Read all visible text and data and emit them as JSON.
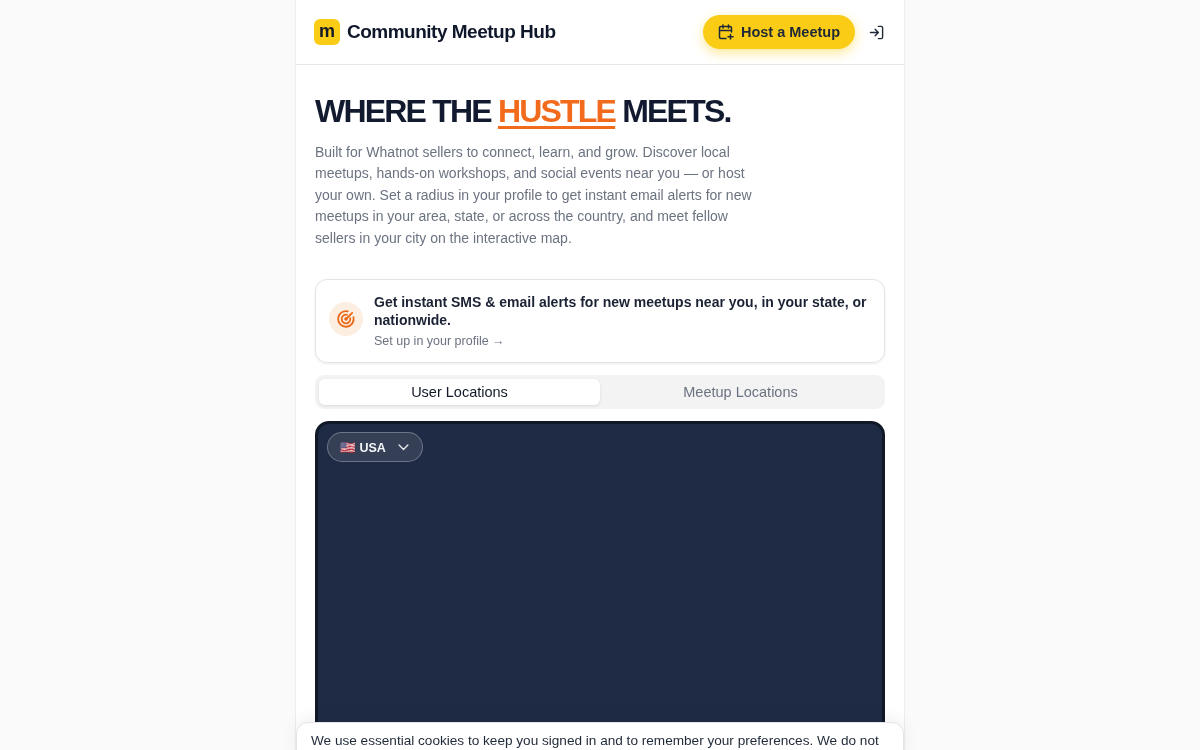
{
  "header": {
    "logo_letter": "m",
    "title": "Community Meetup Hub",
    "host_button": "Host a Meetup"
  },
  "hero": {
    "heading": [
      {
        "text": "WHERE THE",
        "highlight": false
      },
      {
        "text": "HUSTLE",
        "highlight": true
      },
      {
        "text": "MEETS.",
        "highlight": false
      }
    ],
    "description": "Built for Whatnot sellers to connect, learn, and grow. Discover local meetups, hands-on workshops, and social events near you — or host your own. Set a radius in your profile to get instant email alerts for new meetups in your area, state, or across the country, and meet fellow sellers in your city on the interactive map."
  },
  "alert_card": {
    "title": "Get instant SMS & email alerts for new meetups near you, in your state, or nationwide.",
    "link": "Set up in your profile →"
  },
  "map_tabs": [
    {
      "label": "User Locations",
      "selected": true
    },
    {
      "label": "Meetup Locations",
      "selected": false
    }
  ],
  "map": {
    "region_selector": "🇺🇸 USA"
  },
  "cookie_banner": {
    "text": "We use essential cookies to keep you signed in and to remember your preferences. We do not"
  }
}
